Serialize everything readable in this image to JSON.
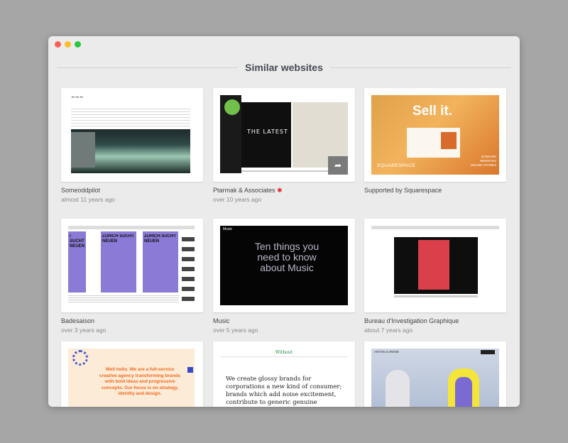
{
  "section_title": "Similar websites",
  "cards": [
    {
      "title": "Someoddpilot",
      "time": "almost 11 years ago"
    },
    {
      "title": "Ptarmak & Associates",
      "time": "over 10 years ago",
      "featured": true
    },
    {
      "title": "Supported by Squarespace",
      "time": ""
    },
    {
      "title": "Badesaison",
      "time": "over 3 years ago"
    },
    {
      "title": "Music",
      "time": "over 5 years ago"
    },
    {
      "title": "Bureau d'Investigation Graphique",
      "time": "about 7 years ago"
    },
    {
      "title": "",
      "time": ""
    },
    {
      "title": "",
      "time": ""
    },
    {
      "title": "",
      "time": ""
    }
  ],
  "thumbs": {
    "latest_heading": "THE LATEST",
    "sell_heading": "Sell it.",
    "squarespace_brand": "SQUARESPACE",
    "squarespace_tagline": "DOMAINS\nWEBSITES\nONLINE STORES",
    "zurich_headline": "ZURICH SUCHT NEUEN",
    "zurich_partial": "I SUCHT NEUEN",
    "music_label": "Music",
    "music_headline": "Ten things you need to know about Music",
    "agency_headline": "Well hello. We are a full-service creative agency transforming brands with bold ideas and progressive concepts. Our focus is on strategy, identity and design.",
    "without_label": "Without",
    "without_text": "We create glossy brands for corporations a new kind of consumer; brands which add noise excitement, contribute to generic genuine experiences and support products to make do with believe in",
    "fashion_label": "ANTON & IRENE"
  },
  "colors": {
    "accent_star": "#e4232b",
    "agency_orange": "#f26a21",
    "without_green": "#1f8a3a"
  },
  "icons": {
    "featured": "star-icon",
    "share": "share-icon"
  }
}
